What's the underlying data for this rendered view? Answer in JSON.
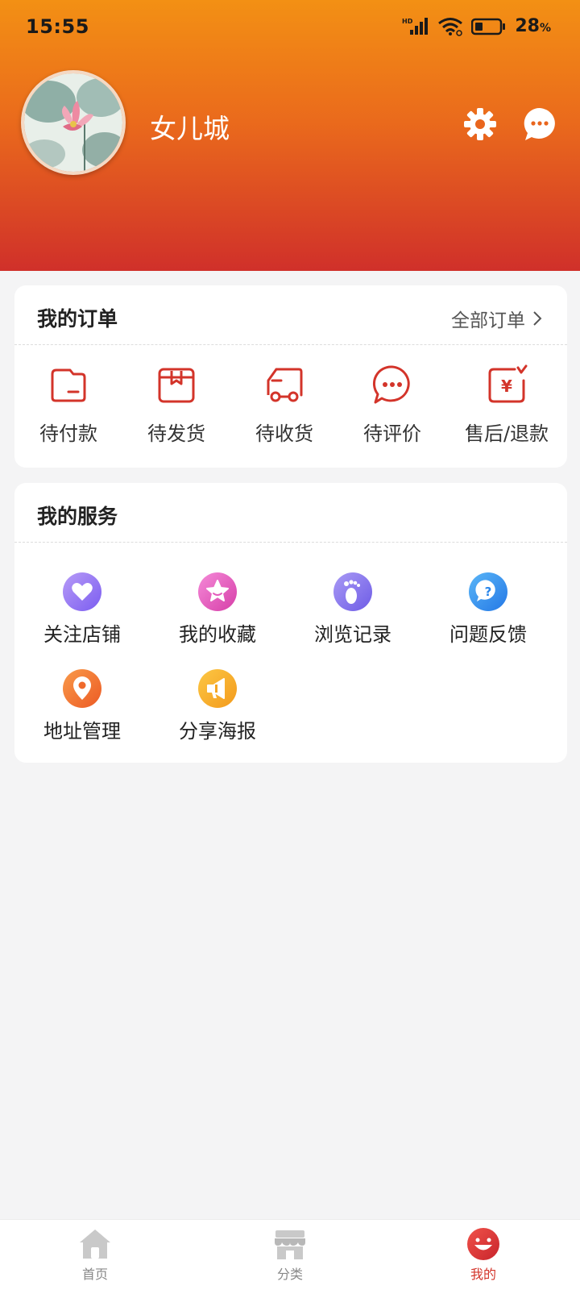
{
  "status_bar": {
    "time": "15:55",
    "battery_percent": "28",
    "battery_unit": "%",
    "network_badge": "HD"
  },
  "profile": {
    "username": "女儿城"
  },
  "orders": {
    "title": "我的订单",
    "all_link": "全部订单",
    "items": [
      {
        "label": "待付款",
        "icon": "wallet-icon"
      },
      {
        "label": "待发货",
        "icon": "package-icon"
      },
      {
        "label": "待收货",
        "icon": "truck-icon"
      },
      {
        "label": "待评价",
        "icon": "comment-icon"
      },
      {
        "label": "售后/退款",
        "icon": "refund-icon"
      }
    ]
  },
  "services": {
    "title": "我的服务",
    "items": [
      {
        "label": "关注店铺",
        "icon": "heart-icon"
      },
      {
        "label": "我的收藏",
        "icon": "star-icon"
      },
      {
        "label": "浏览记录",
        "icon": "footprint-icon"
      },
      {
        "label": "问题反馈",
        "icon": "question-icon"
      },
      {
        "label": "地址管理",
        "icon": "location-icon"
      },
      {
        "label": "分享海报",
        "icon": "megaphone-icon"
      }
    ]
  },
  "tabbar": {
    "items": [
      {
        "label": "首页",
        "icon": "home-icon"
      },
      {
        "label": "分类",
        "icon": "store-icon"
      },
      {
        "label": "我的",
        "icon": "smile-icon"
      }
    ],
    "active": "我的"
  },
  "colors": {
    "accent": "#d3342a",
    "header_top": "#f39014",
    "header_bottom": "#d0302a",
    "background": "#f4f4f5"
  }
}
